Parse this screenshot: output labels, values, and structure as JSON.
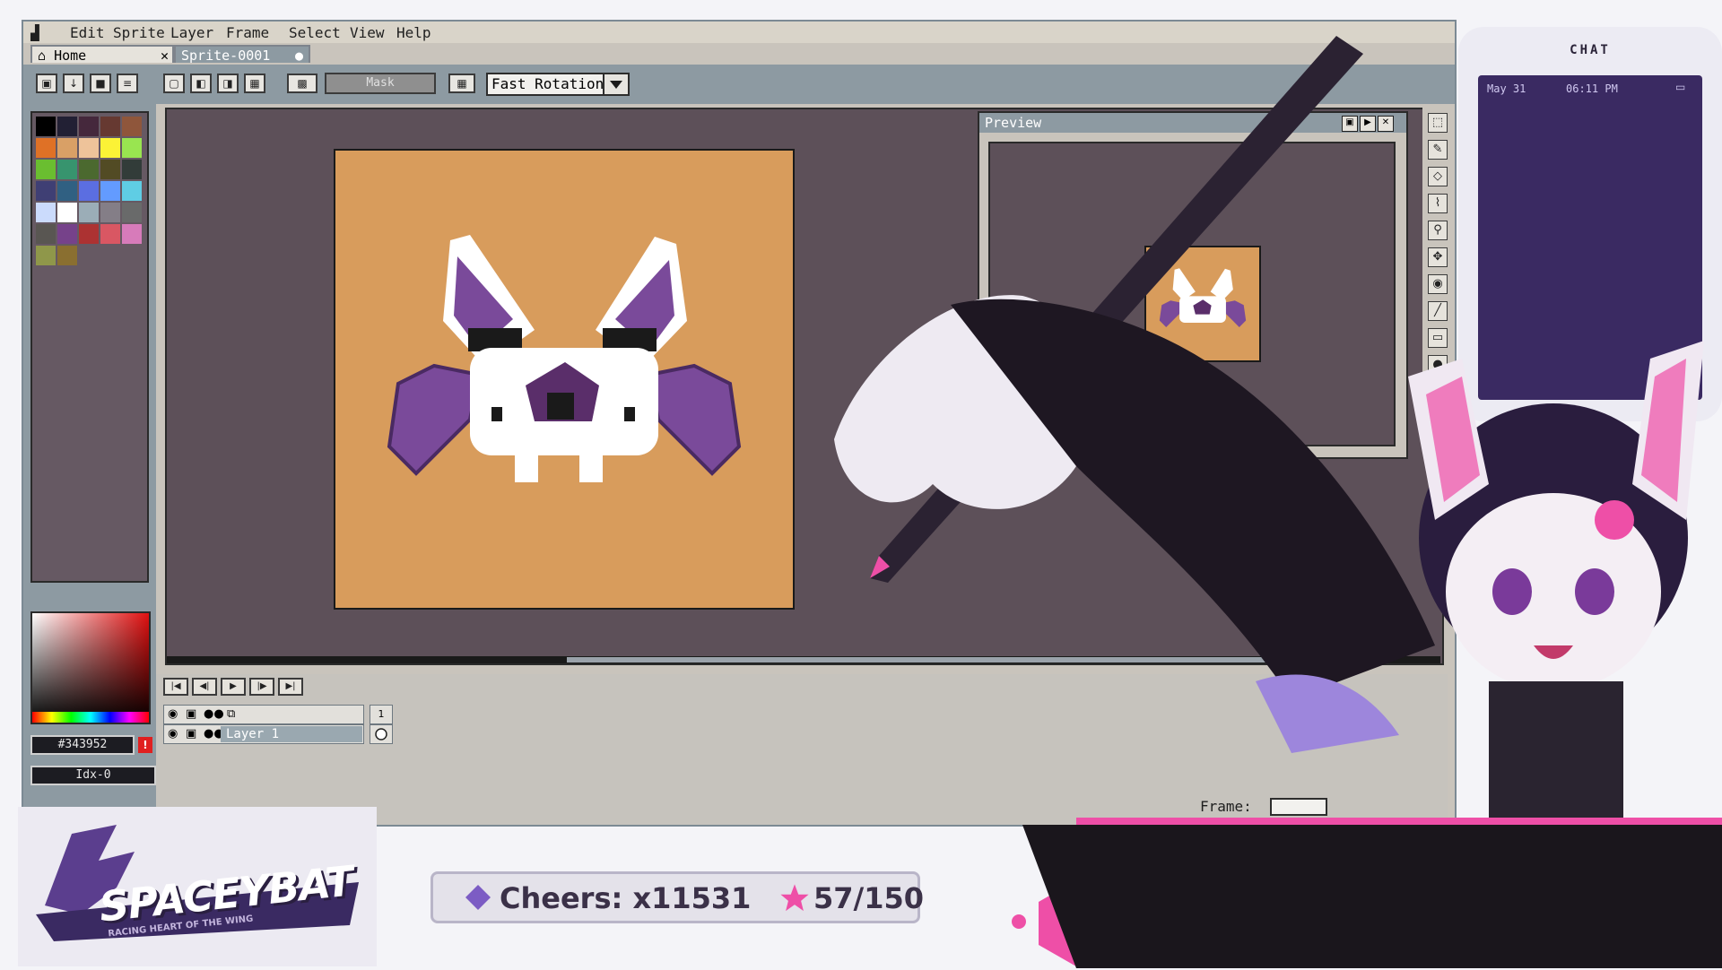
{
  "menubar": {
    "items": [
      "Edit",
      "Sprite",
      "Layer",
      "Frame",
      "Select",
      "View",
      "Help"
    ]
  },
  "tabs": [
    {
      "label": "Home"
    },
    {
      "label": "Sprite-0001"
    }
  ],
  "toolbar": {
    "mask_label": "Mask",
    "rotation_select": "Fast Rotation"
  },
  "color": {
    "hex": "#343952",
    "index": "Idx-0"
  },
  "preview": {
    "title": "Preview"
  },
  "timeline": {
    "frame_number": "1",
    "layer_name": "Layer 1",
    "frame_label": "Frame:"
  },
  "overlay": {
    "brand_title": "SPACEYBAT",
    "brand_tagline": "RACING HEART OF THE WING",
    "cheers": "Cheers: x11531",
    "goal": "57/150"
  },
  "chat": {
    "title": "CHAT",
    "date": "May 31",
    "time": "06:11 PM"
  },
  "colors": {
    "accent_pink": "#ee4fa7",
    "canvas_bg": "#5d5059",
    "sprite_bg": "#d89c5c",
    "bat_purple": "#7a4a9a"
  }
}
